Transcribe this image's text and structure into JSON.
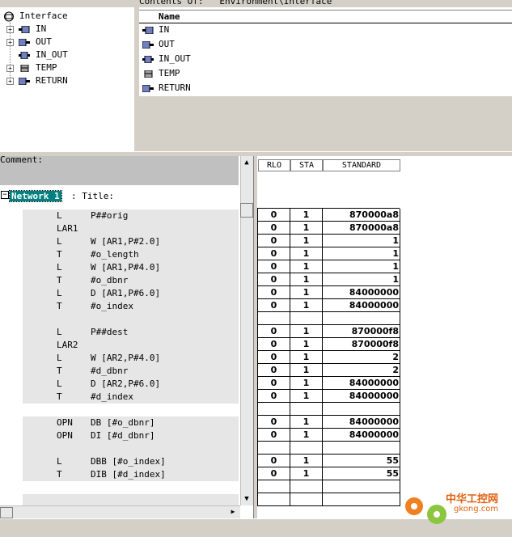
{
  "tree": {
    "root_label": "Interface",
    "items": [
      {
        "label": "IN",
        "expandable": true
      },
      {
        "label": "OUT",
        "expandable": true
      },
      {
        "label": "IN_OUT",
        "expandable": false
      },
      {
        "label": "TEMP",
        "expandable": true
      },
      {
        "label": "RETURN",
        "expandable": true
      }
    ]
  },
  "contents": {
    "caption": "Contents Of:  'Environment\\Interface'",
    "column_name": "Name",
    "items": [
      "IN",
      "OUT",
      "IN_OUT",
      "TEMP",
      "RETURN"
    ]
  },
  "editor": {
    "comment_label": "Comment:",
    "network_label": "Network 1",
    "network_title": ": Title:",
    "lines": [
      {
        "op": "L",
        "arg": "P##orig"
      },
      {
        "op": "LAR1",
        "arg": ""
      },
      {
        "op": "L",
        "arg": "W [AR1,P#2.0]"
      },
      {
        "op": "T",
        "arg": "#o_length"
      },
      {
        "op": "L",
        "arg": "W [AR1,P#4.0]"
      },
      {
        "op": "T",
        "arg": "#o_dbnr"
      },
      {
        "op": "L",
        "arg": "D [AR1,P#6.0]"
      },
      {
        "op": "T",
        "arg": "#o_index"
      },
      {
        "op": "",
        "arg": ""
      },
      {
        "op": "L",
        "arg": "P##dest"
      },
      {
        "op": "LAR2",
        "arg": ""
      },
      {
        "op": "L",
        "arg": "W [AR2,P#4.0]"
      },
      {
        "op": "T",
        "arg": "#d_dbnr"
      },
      {
        "op": "L",
        "arg": "D [AR2,P#6.0]"
      },
      {
        "op": "T",
        "arg": "#d_index"
      },
      {
        "op": "",
        "arg": ""
      },
      {
        "op": "OPN",
        "arg": "DB [#o_dbnr]"
      },
      {
        "op": "OPN",
        "arg": "DI [#d_dbnr]"
      },
      {
        "op": "",
        "arg": ""
      },
      {
        "op": "L",
        "arg": "DBB [#o_index]"
      },
      {
        "op": "T",
        "arg": "DIB [#d_index]"
      },
      {
        "op": "",
        "arg": ""
      },
      {
        "op": "",
        "arg": ""
      }
    ]
  },
  "status": {
    "headers": {
      "rlo": "RLO",
      "sta": "STA",
      "standard": "STANDARD"
    },
    "rows": [
      {
        "rlo": "0",
        "sta": "1",
        "std": "870000a8"
      },
      {
        "rlo": "0",
        "sta": "1",
        "std": "870000a8"
      },
      {
        "rlo": "0",
        "sta": "1",
        "std": "1"
      },
      {
        "rlo": "0",
        "sta": "1",
        "std": "1"
      },
      {
        "rlo": "0",
        "sta": "1",
        "std": "1"
      },
      {
        "rlo": "0",
        "sta": "1",
        "std": "1"
      },
      {
        "rlo": "0",
        "sta": "1",
        "std": "84000000"
      },
      {
        "rlo": "0",
        "sta": "1",
        "std": "84000000"
      },
      {
        "rlo": "",
        "sta": "",
        "std": ""
      },
      {
        "rlo": "0",
        "sta": "1",
        "std": "870000f8"
      },
      {
        "rlo": "0",
        "sta": "1",
        "std": "870000f8"
      },
      {
        "rlo": "0",
        "sta": "1",
        "std": "2"
      },
      {
        "rlo": "0",
        "sta": "1",
        "std": "2"
      },
      {
        "rlo": "0",
        "sta": "1",
        "std": "84000000"
      },
      {
        "rlo": "0",
        "sta": "1",
        "std": "84000000"
      },
      {
        "rlo": "",
        "sta": "",
        "std": ""
      },
      {
        "rlo": "0",
        "sta": "1",
        "std": "84000000"
      },
      {
        "rlo": "0",
        "sta": "1",
        "std": "84000000"
      },
      {
        "rlo": "",
        "sta": "",
        "std": ""
      },
      {
        "rlo": "0",
        "sta": "1",
        "std": "55"
      },
      {
        "rlo": "0",
        "sta": "1",
        "std": "55"
      },
      {
        "rlo": "",
        "sta": "",
        "std": ""
      },
      {
        "rlo": "",
        "sta": "",
        "std": ""
      }
    ]
  },
  "watermark": {
    "line1": "中华工控网",
    "line2": "gkong.com"
  },
  "colors": {
    "network_badge": "#008080",
    "panel_gray": "#d4d0c8",
    "shade_row": "#e6e6e6",
    "watermark": "#e06010"
  }
}
